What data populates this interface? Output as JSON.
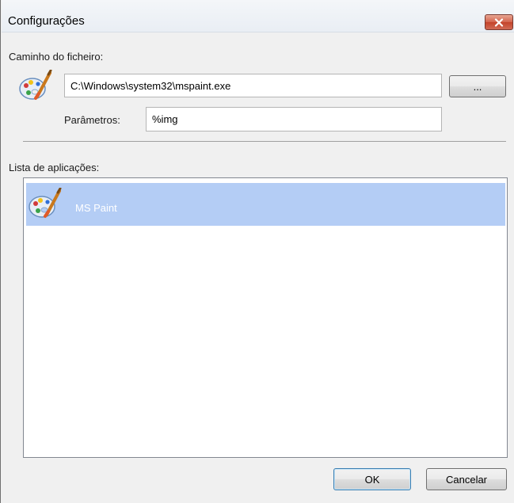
{
  "window": {
    "title": "Configurações",
    "close_icon": "close-icon"
  },
  "file_path": {
    "label": "Caminho do ficheiro:",
    "value": "C:\\Windows\\system32\\mspaint.exe",
    "browse_label": "...",
    "icon": "paint-palette-icon"
  },
  "parameters": {
    "label": "Parâmetros:",
    "value": "%img"
  },
  "app_list": {
    "label": "Lista de aplicações:",
    "items": [
      {
        "name": "MS Paint",
        "icon": "paint-palette-icon",
        "selected": true
      }
    ]
  },
  "buttons": {
    "ok_label": "OK",
    "cancel_label": "Cancelar"
  },
  "colors": {
    "selection": "#b4cdf5",
    "close_button": "#c4432a",
    "dialog_background": "#f0f0f0"
  }
}
